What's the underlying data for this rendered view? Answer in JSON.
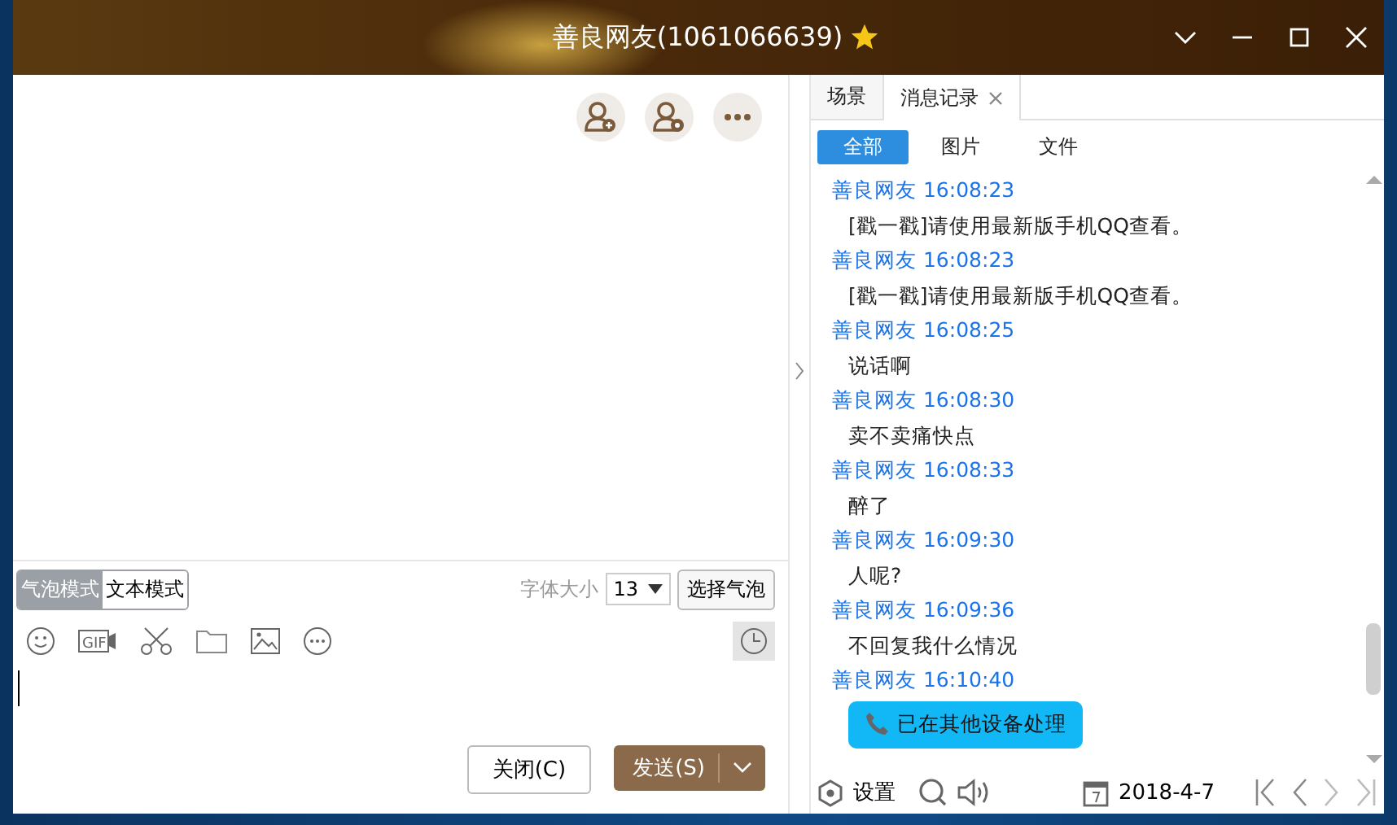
{
  "window": {
    "title": "善良网友(1061066639)"
  },
  "chat_actions": [
    {
      "kind": "add-friend"
    },
    {
      "kind": "contact-settings"
    },
    {
      "kind": "more"
    }
  ],
  "modes": [
    {
      "label": "气泡模式",
      "selected": true
    },
    {
      "label": "文本模式",
      "selected": false
    }
  ],
  "font_size": {
    "label": "字体大小",
    "value": "13"
  },
  "bubble_button": "选择气泡",
  "gif_label": "GIF",
  "buttons": {
    "close": "关闭(C)",
    "send": "发送(S)"
  },
  "side_tabs": [
    {
      "label": "场景",
      "selected": false,
      "closable": false
    },
    {
      "label": "消息记录",
      "selected": true,
      "closable": true
    }
  ],
  "filters": [
    {
      "label": "全部",
      "selected": true
    },
    {
      "label": "图片",
      "selected": false
    },
    {
      "label": "文件",
      "selected": false
    }
  ],
  "messages": [
    {
      "sender": "善良网友",
      "time": "16:08:23",
      "kind": "text",
      "text": "[戳一戳]请使用最新版手机QQ查看。"
    },
    {
      "sender": "善良网友",
      "time": "16:08:23",
      "kind": "text",
      "text": "[戳一戳]请使用最新版手机QQ查看。"
    },
    {
      "sender": "善良网友",
      "time": "16:08:25",
      "kind": "text",
      "text": "说话啊"
    },
    {
      "sender": "善良网友",
      "time": "16:08:30",
      "kind": "text",
      "text": "卖不卖痛快点"
    },
    {
      "sender": "善良网友",
      "time": "16:08:33",
      "kind": "text",
      "text": "醉了"
    },
    {
      "sender": "善良网友",
      "time": "16:09:30",
      "kind": "text",
      "text": "人呢?"
    },
    {
      "sender": "善良网友",
      "time": "16:09:36",
      "kind": "text",
      "text": "不回复我什么情况"
    },
    {
      "sender": "善良网友",
      "time": "16:10:40",
      "kind": "call",
      "text": "已在其他设备处理"
    }
  ],
  "footer": {
    "settings": "设置",
    "date": "2018-4-7"
  }
}
